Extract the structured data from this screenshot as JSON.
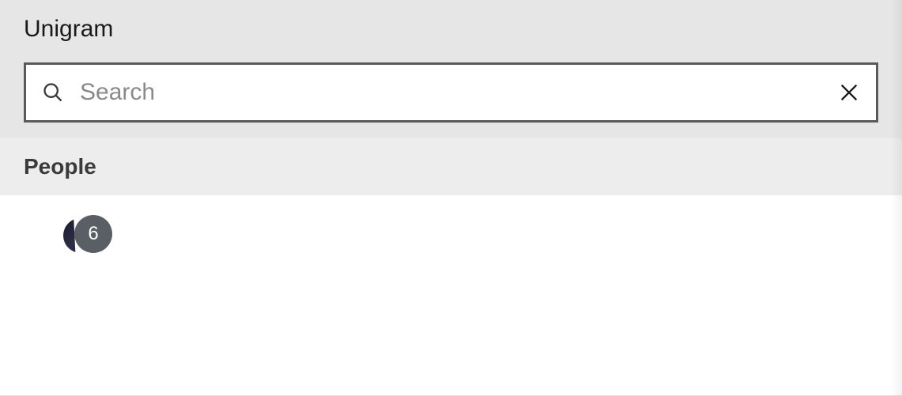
{
  "app": {
    "title": "Unigram"
  },
  "search": {
    "placeholder": "Search",
    "value": ""
  },
  "sections": {
    "people_label": "People"
  },
  "people": [
    {
      "badge_count": "6"
    }
  ]
}
